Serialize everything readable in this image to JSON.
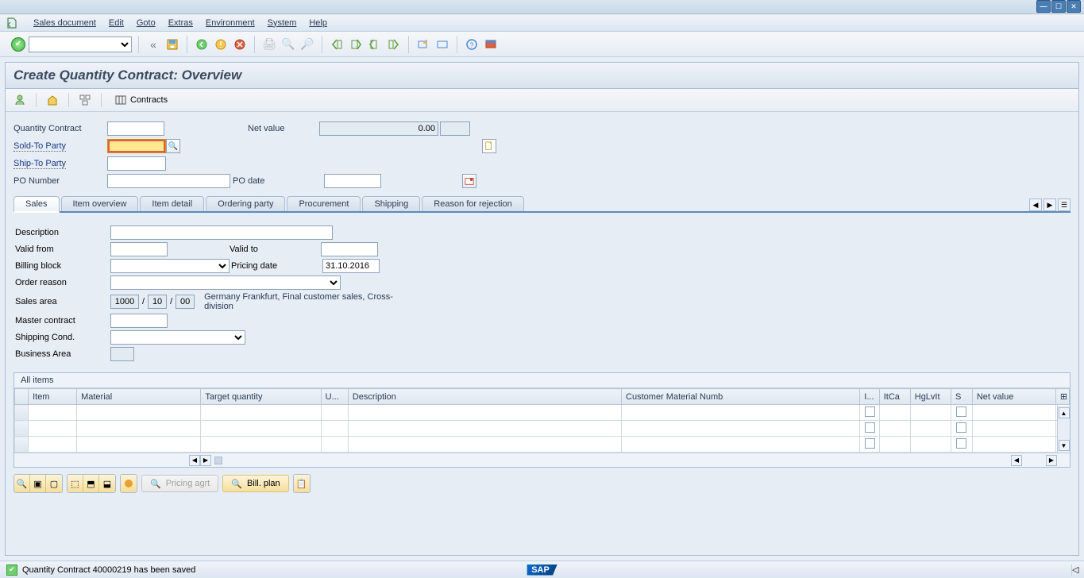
{
  "window": {
    "title": "Create Quantity Contract: Overview"
  },
  "menu": {
    "items": [
      "Sales document",
      "Edit",
      "Goto",
      "Extras",
      "Environment",
      "System",
      "Help"
    ]
  },
  "page_title": "Create Quantity Contract: Overview",
  "sub_toolbar": {
    "contracts_label": "Contracts"
  },
  "header_form": {
    "qty_contract_label": "Quantity Contract",
    "qty_contract_value": "",
    "net_value_label": "Net value",
    "net_value": "0.00",
    "sold_to_label": "Sold-To Party",
    "sold_to_value": "",
    "ship_to_label": "Ship-To Party",
    "ship_to_value": "",
    "po_number_label": "PO Number",
    "po_number_value": "",
    "po_date_label": "PO date",
    "po_date_value": ""
  },
  "tabs": {
    "items": [
      "Sales",
      "Item overview",
      "Item detail",
      "Ordering party",
      "Procurement",
      "Shipping",
      "Reason for rejection"
    ],
    "active": 0
  },
  "sales_tab": {
    "description_label": "Description",
    "description_value": "",
    "valid_from_label": "Valid from",
    "valid_from_value": "",
    "valid_to_label": "Valid to",
    "valid_to_value": "",
    "billing_block_label": "Billing block",
    "billing_block_value": "",
    "pricing_date_label": "Pricing date",
    "pricing_date_value": "31.10.2016",
    "order_reason_label": "Order reason",
    "order_reason_value": "",
    "sales_area_label": "Sales area",
    "sales_area_org": "1000",
    "sales_area_ch": "10",
    "sales_area_div": "00",
    "sales_area_text": "Germany Frankfurt, Final customer sales, Cross-division",
    "master_contract_label": "Master contract",
    "master_contract_value": "",
    "shipping_cond_label": "Shipping Cond.",
    "shipping_cond_value": "",
    "business_area_label": "Business Area",
    "business_area_value": ""
  },
  "items_panel": {
    "title": "All items",
    "columns": [
      "Item",
      "Material",
      "Target quantity",
      "U...",
      "Description",
      "Customer Material Numb",
      "I...",
      "ItCa",
      "HgLvIt",
      "S",
      "Net value"
    ],
    "rows": [
      {
        "item": "",
        "material": "",
        "target_qty": "",
        "uom": "",
        "desc": "",
        "cust_mat": "",
        "i": false,
        "itca": "",
        "hglv": "",
        "s": false,
        "net": ""
      },
      {
        "item": "",
        "material": "",
        "target_qty": "",
        "uom": "",
        "desc": "",
        "cust_mat": "",
        "i": false,
        "itca": "",
        "hglv": "",
        "s": false,
        "net": ""
      },
      {
        "item": "",
        "material": "",
        "target_qty": "",
        "uom": "",
        "desc": "",
        "cust_mat": "",
        "i": false,
        "itca": "",
        "hglv": "",
        "s": false,
        "net": ""
      }
    ]
  },
  "bottom": {
    "pricing_agrt": "Pricing agrt",
    "bill_plan": "Bill. plan"
  },
  "status": {
    "message": "Quantity Contract 40000219 has been saved",
    "logo": "SAP"
  }
}
